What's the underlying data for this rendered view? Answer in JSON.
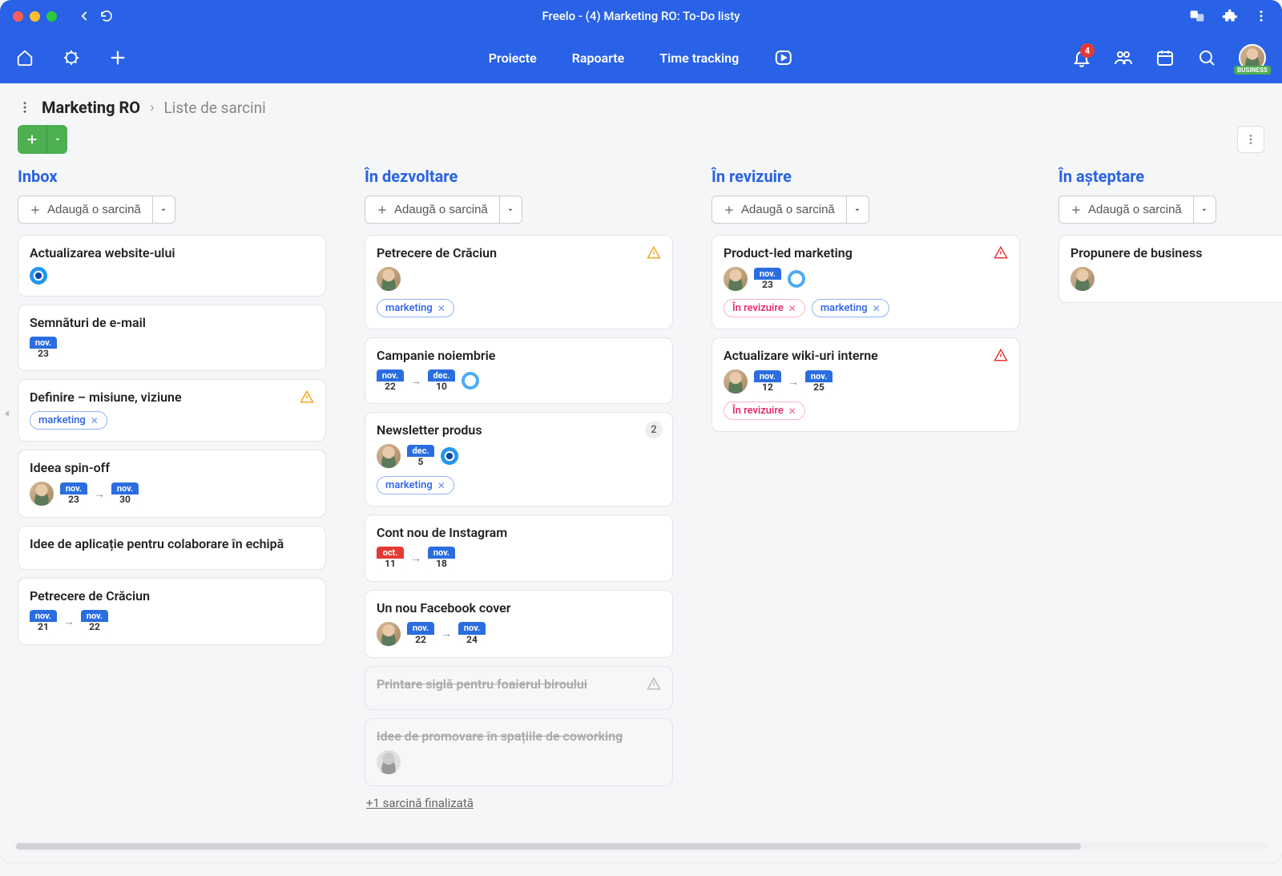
{
  "window": {
    "title": "Freelo - (4) Marketing RO: To-Do listy"
  },
  "nav": {
    "projects": "Proiecte",
    "reports": "Rapoarte",
    "time_tracking": "Time tracking",
    "notif_badge": "4",
    "business_tag": "BUSINESS"
  },
  "breadcrumb": {
    "project": "Marketing RO",
    "current": "Liste de sarcini"
  },
  "add_task_label": "Adaugă o sarcină",
  "columns": [
    {
      "title": "Inbox",
      "cards": [
        {
          "title": "Actualizarea website-ului",
          "prio": "filled"
        },
        {
          "title": "Semnături de e-mail",
          "date_single": {
            "m": "nov.",
            "d": "23"
          }
        },
        {
          "title": "Definire – misiune, viziune",
          "warn": "orange",
          "tags_blue": [
            "marketing"
          ]
        },
        {
          "title": "Ideea spin-off",
          "avatar": true,
          "date_from": {
            "m": "nov.",
            "d": "23"
          },
          "date_to": {
            "m": "nov.",
            "d": "30"
          }
        },
        {
          "title": "Idee de aplicație pentru colaborare în echipă"
        },
        {
          "title": "Petrecere de Crăciun",
          "date_from": {
            "m": "nov.",
            "d": "21"
          },
          "date_to": {
            "m": "nov.",
            "d": "22"
          }
        }
      ]
    },
    {
      "title": "În dezvoltare",
      "cards": [
        {
          "title": "Petrecere de Crăciun",
          "warn": "orange",
          "avatar": true,
          "tags_blue": [
            "marketing"
          ]
        },
        {
          "title": "Campanie noiembrie",
          "date_from": {
            "m": "nov.",
            "d": "22"
          },
          "date_to": {
            "m": "dec.",
            "d": "10"
          },
          "prio": "open"
        },
        {
          "title": "Newsletter produs",
          "count": "2",
          "avatar": true,
          "date_single": {
            "m": "dec.",
            "d": "5"
          },
          "prio": "filled",
          "tags_blue": [
            "marketing"
          ]
        },
        {
          "title": "Cont nou de Instagram",
          "date_from": {
            "m": "oct.",
            "d": "11",
            "red": true
          },
          "date_to": {
            "m": "nov.",
            "d": "18"
          }
        },
        {
          "title": "Un nou Facebook cover",
          "avatar": true,
          "date_from": {
            "m": "nov.",
            "d": "22"
          },
          "date_to": {
            "m": "nov.",
            "d": "24"
          }
        },
        {
          "title": "Printare siglă pentru foaierul biroului",
          "done": true,
          "warn": "grey"
        },
        {
          "title": "Idee de promovare în spațiile de coworking",
          "done": true,
          "avatar_grey": true
        }
      ],
      "completed_link": "+1 sarcină finalizată"
    },
    {
      "title": "În revizuire",
      "cards": [
        {
          "title": "Product-led marketing",
          "warn": "red",
          "avatar": true,
          "date_single": {
            "m": "nov.",
            "d": "23"
          },
          "prio": "open",
          "tags_pink": [
            "În revizuire"
          ],
          "tags_blue": [
            "marketing"
          ]
        },
        {
          "title": "Actualizare wiki-uri interne",
          "warn": "red",
          "avatar": true,
          "date_from": {
            "m": "nov.",
            "d": "12"
          },
          "date_to": {
            "m": "nov.",
            "d": "25"
          },
          "tags_pink": [
            "În revizuire"
          ]
        }
      ]
    },
    {
      "title": "În așteptare",
      "cards": [
        {
          "title": "Propunere de business",
          "avatar": true
        }
      ]
    }
  ]
}
